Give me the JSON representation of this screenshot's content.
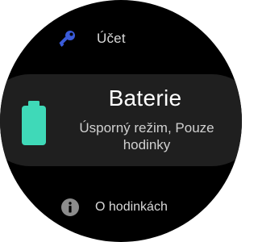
{
  "menu": {
    "items": [
      {
        "label": "Účet",
        "icon": "key-icon"
      },
      {
        "label": "Baterie",
        "subtitle": "Úsporný režim, Pouze hodinky",
        "icon": "battery-icon"
      },
      {
        "label": "O hodinkách",
        "icon": "info-icon"
      }
    ]
  },
  "colors": {
    "background": "#000000",
    "focused_item_background": "#1f1f1f",
    "key_icon": "#3a5bd9",
    "battery_icon": "#3fd9b8",
    "info_icon": "#8c8c8c"
  }
}
